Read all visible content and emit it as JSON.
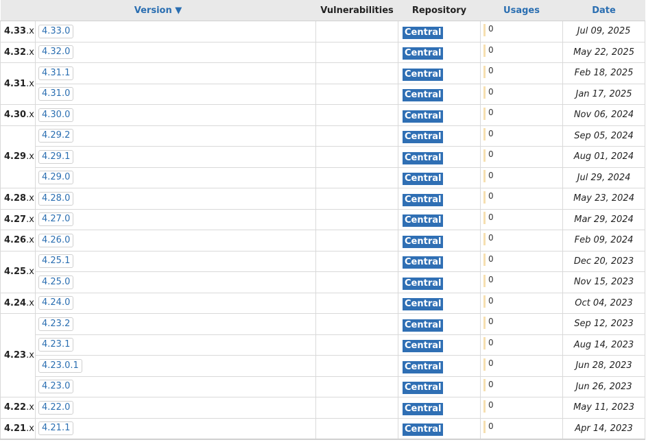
{
  "table": {
    "headers": {
      "version": "Version ▼",
      "vulnerabilities": "Vulnerabilities",
      "repository": "Repository",
      "usages": "Usages",
      "date": "Date"
    },
    "colors": {
      "accent": "#2a6eb1",
      "badge": "#2f6fb4",
      "usage_bar": "#f6dfb0"
    },
    "groups": [
      {
        "minor": "4.33",
        "suffix": ".x",
        "versions": [
          {
            "version": "4.33.0",
            "repository": "Central",
            "usages": "0",
            "date": "Jul 09, 2025"
          }
        ]
      },
      {
        "minor": "4.32",
        "suffix": ".x",
        "versions": [
          {
            "version": "4.32.0",
            "repository": "Central",
            "usages": "0",
            "date": "May 22, 2025"
          }
        ]
      },
      {
        "minor": "4.31",
        "suffix": ".x",
        "versions": [
          {
            "version": "4.31.1",
            "repository": "Central",
            "usages": "0",
            "date": "Feb 18, 2025"
          },
          {
            "version": "4.31.0",
            "repository": "Central",
            "usages": "0",
            "date": "Jan 17, 2025"
          }
        ]
      },
      {
        "minor": "4.30",
        "suffix": ".x",
        "versions": [
          {
            "version": "4.30.0",
            "repository": "Central",
            "usages": "0",
            "date": "Nov 06, 2024"
          }
        ]
      },
      {
        "minor": "4.29",
        "suffix": ".x",
        "versions": [
          {
            "version": "4.29.2",
            "repository": "Central",
            "usages": "0",
            "date": "Sep 05, 2024"
          },
          {
            "version": "4.29.1",
            "repository": "Central",
            "usages": "0",
            "date": "Aug 01, 2024"
          },
          {
            "version": "4.29.0",
            "repository": "Central",
            "usages": "0",
            "date": "Jul 29, 2024"
          }
        ]
      },
      {
        "minor": "4.28",
        "suffix": ".x",
        "versions": [
          {
            "version": "4.28.0",
            "repository": "Central",
            "usages": "0",
            "date": "May 23, 2024"
          }
        ]
      },
      {
        "minor": "4.27",
        "suffix": ".x",
        "versions": [
          {
            "version": "4.27.0",
            "repository": "Central",
            "usages": "0",
            "date": "Mar 29, 2024"
          }
        ]
      },
      {
        "minor": "4.26",
        "suffix": ".x",
        "versions": [
          {
            "version": "4.26.0",
            "repository": "Central",
            "usages": "0",
            "date": "Feb 09, 2024"
          }
        ]
      },
      {
        "minor": "4.25",
        "suffix": ".x",
        "versions": [
          {
            "version": "4.25.1",
            "repository": "Central",
            "usages": "0",
            "date": "Dec 20, 2023"
          },
          {
            "version": "4.25.0",
            "repository": "Central",
            "usages": "0",
            "date": "Nov 15, 2023"
          }
        ]
      },
      {
        "minor": "4.24",
        "suffix": ".x",
        "versions": [
          {
            "version": "4.24.0",
            "repository": "Central",
            "usages": "0",
            "date": "Oct 04, 2023"
          }
        ]
      },
      {
        "minor": "4.23",
        "suffix": ".x",
        "versions": [
          {
            "version": "4.23.2",
            "repository": "Central",
            "usages": "0",
            "date": "Sep 12, 2023"
          },
          {
            "version": "4.23.1",
            "repository": "Central",
            "usages": "0",
            "date": "Aug 14, 2023"
          },
          {
            "version": "4.23.0.1",
            "repository": "Central",
            "usages": "0",
            "date": "Jun 28, 2023"
          },
          {
            "version": "4.23.0",
            "repository": "Central",
            "usages": "0",
            "date": "Jun 26, 2023"
          }
        ]
      },
      {
        "minor": "4.22",
        "suffix": ".x",
        "versions": [
          {
            "version": "4.22.0",
            "repository": "Central",
            "usages": "0",
            "date": "May 11, 2023"
          }
        ]
      },
      {
        "minor": "4.21",
        "suffix": ".x",
        "versions": [
          {
            "version": "4.21.1",
            "repository": "Central",
            "usages": "0",
            "date": "Apr 14, 2023"
          }
        ]
      }
    ]
  }
}
